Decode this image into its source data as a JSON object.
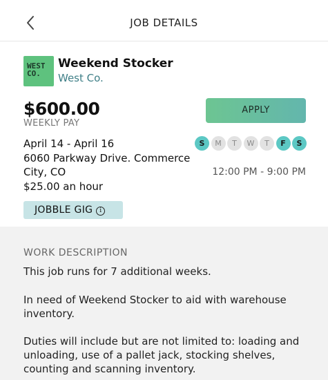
{
  "header": {
    "title": "JOB DETAILS",
    "back_icon": "chevron-left-icon"
  },
  "job": {
    "logo_text_line1": "WEST",
    "logo_text_line2": "CO.",
    "title": "Weekend Stocker",
    "company": "West Co.",
    "pay": "$600.00",
    "pay_label": "WEEKLY PAY",
    "apply_label": "APPLY",
    "dates": "April 14 - April 16",
    "address_line1": "6060 Parkway Drive. Commerce",
    "address_line2": "City, CO",
    "hourly_rate": "$25.00 an hour",
    "hours": "12:00 PM - 9:00 PM",
    "days": [
      {
        "label": "S",
        "active": true
      },
      {
        "label": "M",
        "active": false
      },
      {
        "label": "T",
        "active": false
      },
      {
        "label": "W",
        "active": false
      },
      {
        "label": "T",
        "active": false
      },
      {
        "label": "F",
        "active": true
      },
      {
        "label": "S",
        "active": true
      }
    ],
    "gig_badge": "JOBBLE GIG",
    "gig_info_icon": "info-icon"
  },
  "description": {
    "heading": "WORK DESCRIPTION",
    "paragraphs": [
      "This job runs for 7 additional weeks.",
      "In need of Weekend Stocker to aid with warehouse inventory.",
      "Duties will include but are not limited to: loading and unloading, use of a pallet jack, stocking shelves, counting and scanning inventory."
    ]
  },
  "colors": {
    "accent_teal": "#5cc8c4",
    "company_text": "#3f7f87",
    "logo_bg": "#5ec27e",
    "badge_bg": "#c7e4e6"
  }
}
